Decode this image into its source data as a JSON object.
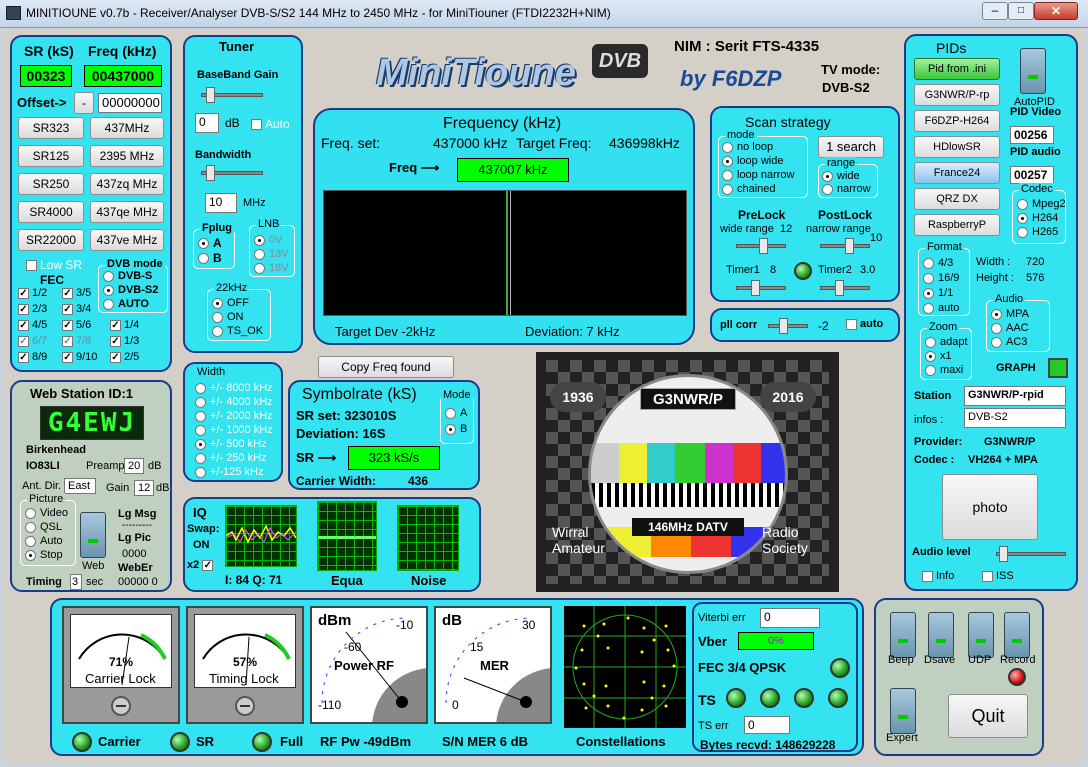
{
  "window": {
    "title": "MINITIOUNE v0.7b - Receiver/Analyser DVB-S/S2 144 MHz to 2450 MHz - for MiniTiouner (FTDI2232H+NIM)"
  },
  "sr": {
    "sr_label": "SR (kS)",
    "freq_label": "Freq (kHz)",
    "sr_value": "00323",
    "freq_value": "00437000",
    "offset_label": "Offset->",
    "offset_sign": "-",
    "offset_value": "00000000",
    "presets": [
      [
        "SR323",
        "437MHz"
      ],
      [
        "SR125",
        "2395 MHz"
      ],
      [
        "SR250",
        "437zq MHz"
      ],
      [
        "SR4000",
        "437qe MHz"
      ],
      [
        "SR22000",
        "437ve MHz"
      ]
    ],
    "low_sr": "Low SR",
    "fec_label": "FEC",
    "fec": [
      "1/2",
      "3/5",
      "2/3",
      "3/4",
      "4/5",
      "5/6",
      "6/7",
      "7/8",
      "8/9",
      "9/10"
    ],
    "dvb_mode_label": "DVB mode",
    "dvb_modes": [
      "DVB-S",
      "DVB-S2",
      "AUTO"
    ],
    "fec_extra": [
      "1/4",
      "1/3",
      "2/5"
    ]
  },
  "tuner": {
    "title": "Tuner",
    "bb_gain_label": "BaseBand Gain",
    "bb_gain": "0",
    "db": "dB",
    "auto": "Auto",
    "bandwidth_label": "Bandwidth",
    "bandwidth": "10",
    "mhz": "MHz",
    "fplug_label": "Fplug",
    "fplug": [
      "A",
      "B"
    ],
    "lnb_label": "LNB",
    "lnb": [
      "0V",
      "13V",
      "18V"
    ],
    "k22_label": "22kHz",
    "k22": [
      "OFF",
      "ON",
      "TS_OK"
    ]
  },
  "header": {
    "nim": "NIM : Serit FTS-4335",
    "tv_mode_label": "TV mode:",
    "tv_mode": "DVB-S2",
    "logo": "MiniTioune",
    "logo_dvb": "DVB",
    "by": "by F6DZP"
  },
  "freq": {
    "title": "Frequency (kHz)",
    "set_label": "Freq. set:",
    "set": "437000 kHz",
    "target_label": "Target Freq:",
    "target": "436998kHz",
    "freq_label": "Freq ⟶",
    "freq": "437007 kHz",
    "target_dev": "Target Dev -2kHz",
    "deviation": "Deviation: 7 kHz"
  },
  "scan": {
    "title": "Scan strategy",
    "mode_label": "mode",
    "modes": [
      "no loop",
      "loop wide",
      "loop narrow",
      "chained"
    ],
    "search": "1 search",
    "range_label": "range",
    "ranges": [
      "wide",
      "narrow"
    ],
    "prelock": "PreLock",
    "prelock_sub": "wide range",
    "prelock_val": "12",
    "postlock": "PostLock",
    "postlock_sub": "narrow range",
    "postlock_val": "10",
    "timer1": "Timer1",
    "timer1_val": "8",
    "timer2": "Timer2",
    "timer2_val": "3.0"
  },
  "pll": {
    "label": "pll corr",
    "value": "-2",
    "auto": "auto"
  },
  "copy_btn": "Copy Freq found",
  "width": {
    "title": "Width",
    "options": [
      "+/- 8000 kHz",
      "+/- 4000 kHz",
      "+/- 2000 kHz",
      "+/- 1000 kHz",
      "+/- 500 kHz",
      "+/- 250 kHz",
      "+/-125 kHz"
    ]
  },
  "symbol": {
    "title": "Symbolrate (kS)",
    "set": "SR set:  323010S",
    "deviation": "Deviation: 16S",
    "sr_label": "SR ⟶",
    "sr": "323 kS/s",
    "carrier": "Carrier Width:",
    "carrier_val": "436",
    "mode_label": "Mode",
    "modes": [
      "A",
      "B"
    ]
  },
  "iq": {
    "title": "IQ",
    "swap": "Swap:",
    "on": "ON",
    "x2": "x2",
    "iq_vals": "I: 84 Q: 71",
    "equa": "Equa",
    "noise": "Noise"
  },
  "web": {
    "title": "Web Station ID:1",
    "callsign": "G4EWJ",
    "city": "Birkenhead",
    "locator": "IO83LI",
    "preamp": "Preamp",
    "preamp_val": "20",
    "db": "dB",
    "ant": "Ant. Dir.",
    "ant_val": "East",
    "gain": "Gain",
    "gain_val": "12",
    "picture_label": "Picture",
    "pictures": [
      "Video",
      "QSL",
      "Auto",
      "Stop"
    ],
    "lg_msg": "Lg Msg",
    "dashes": "---------",
    "lg_pic": "Lg Pic",
    "lg_pic_val": "0000",
    "webr": "WebEr",
    "webr_val": "00000  0",
    "web_sw": "Web",
    "timing": "Timing",
    "timing_val": "3",
    "sec": "sec"
  },
  "video": {
    "call": "G3NWR/P",
    "y1": "1936",
    "y2": "2016",
    "left": "Wirral\nAmateur",
    "right": "Radio\nSociety",
    "band": "146MHz DATV"
  },
  "pids": {
    "title": "PIDs",
    "buttons": [
      "Pid from .ini",
      "G3NWR/P-rp",
      "F6DZP-H264",
      "HDlowSR",
      "France24",
      "QRZ DX",
      "RaspberryP"
    ],
    "autopid": "AutoPID",
    "pid_video_label": "PID Video",
    "pid_video": "00256",
    "pid_audio_label": "PID audio",
    "pid_audio": "00257",
    "codec_label": "Codec",
    "codecs": [
      "Mpeg2",
      "H264",
      "H265"
    ],
    "format_label": "Format",
    "formats": [
      "4/3",
      "16/9",
      "1/1",
      "auto"
    ],
    "width": "Width :",
    "width_val": "720",
    "height": "Height :",
    "height_val": "576",
    "audio_label": "Audio",
    "audios": [
      "MPA",
      "AAC",
      "AC3"
    ],
    "zoom_label": "Zoom",
    "zooms": [
      "adapt",
      "x1",
      "maxi"
    ],
    "graph": "GRAPH",
    "station_label": "Station",
    "station": "G3NWR/P-rpid",
    "infos_label": "infos :",
    "infos": "DVB-S2",
    "provider_label": "Provider:",
    "provider": "G3NWR/P",
    "codec_info_label": "Codec :",
    "codec_info": "VH264 + MPA",
    "photo": "photo",
    "audio_level": "Audio level",
    "info": "Info",
    "iss": "ISS"
  },
  "bottom": {
    "m1_val": "71%",
    "m1_lbl": "Carrier Lock",
    "m2_val": "57%",
    "m2_lbl": "Timing Lock",
    "m3_unit": "dBm",
    "m3_lbl": "Power RF",
    "m3_t1": "-10",
    "m3_t2": "-60",
    "m3_t3": "-110",
    "m4_unit": "dB",
    "m4_lbl": "MER",
    "m4_t1": "30",
    "m4_t2": "15",
    "m4_t3": "0",
    "carrier": "Carrier",
    "sr": "SR",
    "full": "Full",
    "rfpw": "RF Pw -49dBm",
    "snmer": "S/N MER  6 dB",
    "const": "Constellations"
  },
  "viterbi": {
    "label": "Viterbi err",
    "value": "0",
    "vber": "Vber",
    "vber_val": "0%",
    "fec": "FEC 3/4 QPSK",
    "ts": "TS",
    "ts_err": "TS err",
    "ts_err_val": "0",
    "bytes": "Bytes recvd:  148629228"
  },
  "controls": {
    "beep": "Beep",
    "dsave": "Dsave",
    "udp": "UDP",
    "record": "Record",
    "expert": "Expert",
    "quit": "Quit"
  }
}
